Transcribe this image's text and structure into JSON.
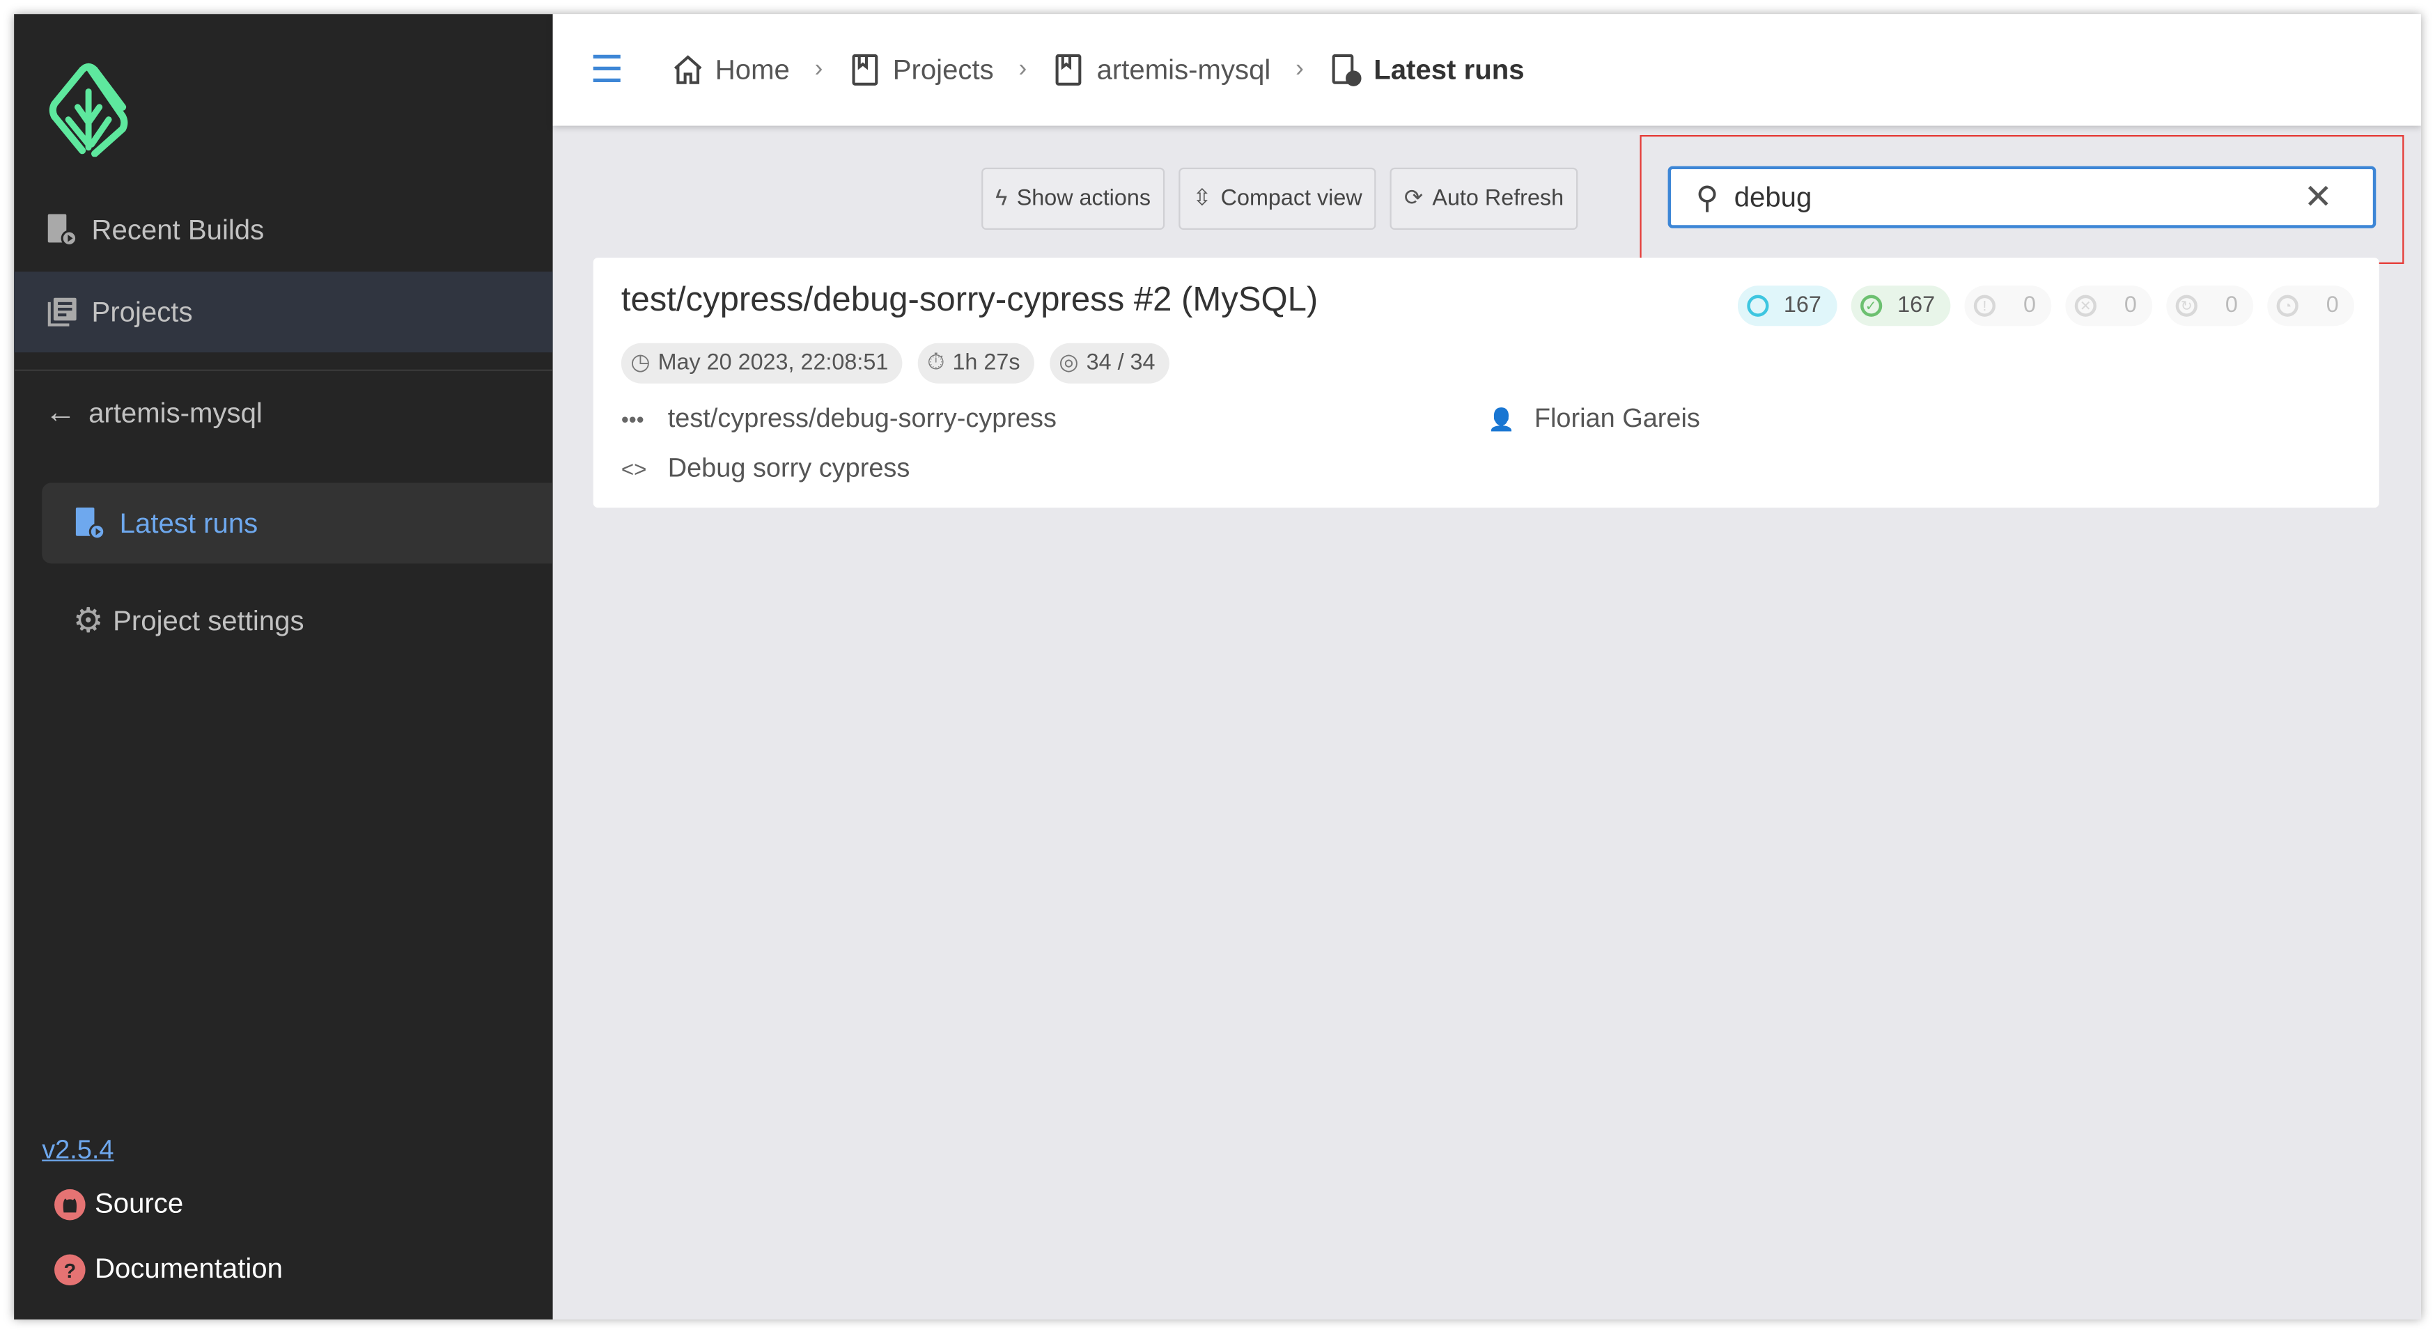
{
  "sidebar": {
    "nav": [
      {
        "label": "Recent Builds",
        "icon": "recent-builds-icon"
      },
      {
        "label": "Projects",
        "icon": "projects-icon",
        "active": true
      }
    ],
    "back_label": "artemis-mysql",
    "sub": [
      {
        "label": "Latest runs",
        "active": true
      },
      {
        "label": "Project settings"
      }
    ],
    "version": "v2.5.4",
    "source": "Source",
    "docs": "Documentation"
  },
  "breadcrumb": [
    {
      "label": "Home",
      "icon": "home-icon"
    },
    {
      "label": "Projects",
      "icon": "bookmark-icon"
    },
    {
      "label": "artemis-mysql",
      "icon": "bookmark-icon"
    },
    {
      "label": "Latest runs",
      "icon": "latest-runs-icon"
    }
  ],
  "toolbar": {
    "show_actions": "Show actions",
    "compact_view": "Compact view",
    "auto_refresh": "Auto Refresh"
  },
  "search": {
    "value": "debug"
  },
  "run": {
    "title": "test/cypress/debug-sorry-cypress #2 (MySQL)",
    "date": "May 20 2023, 22:08:51",
    "duration": "1h 27s",
    "specs": "34 / 34",
    "branch": "test/cypress/debug-sorry-cypress",
    "commit": "Debug sorry cypress",
    "author": "Florian Gareis",
    "stats": [
      {
        "name": "tests",
        "value": "167",
        "color": "#3ec6e0",
        "bg": "#e0f6fa"
      },
      {
        "name": "passed",
        "value": "167",
        "color": "#6cc070",
        "bg": "#e8f5e9"
      },
      {
        "name": "failed",
        "value": "0",
        "color": "#d8d8d8",
        "bg": "#f8f8f8"
      },
      {
        "name": "skipped",
        "value": "0",
        "color": "#d8d8d8",
        "bg": "#f8f8f8"
      },
      {
        "name": "pending",
        "value": "0",
        "color": "#d8d8d8",
        "bg": "#f8f8f8"
      },
      {
        "name": "flaky",
        "value": "0",
        "color": "#d8d8d8",
        "bg": "#f8f8f8"
      }
    ]
  },
  "colors": {
    "sidebar": "#252525",
    "accent": "#6ea8ee",
    "logo": "#5ee89e",
    "highlight": "#e53935"
  }
}
